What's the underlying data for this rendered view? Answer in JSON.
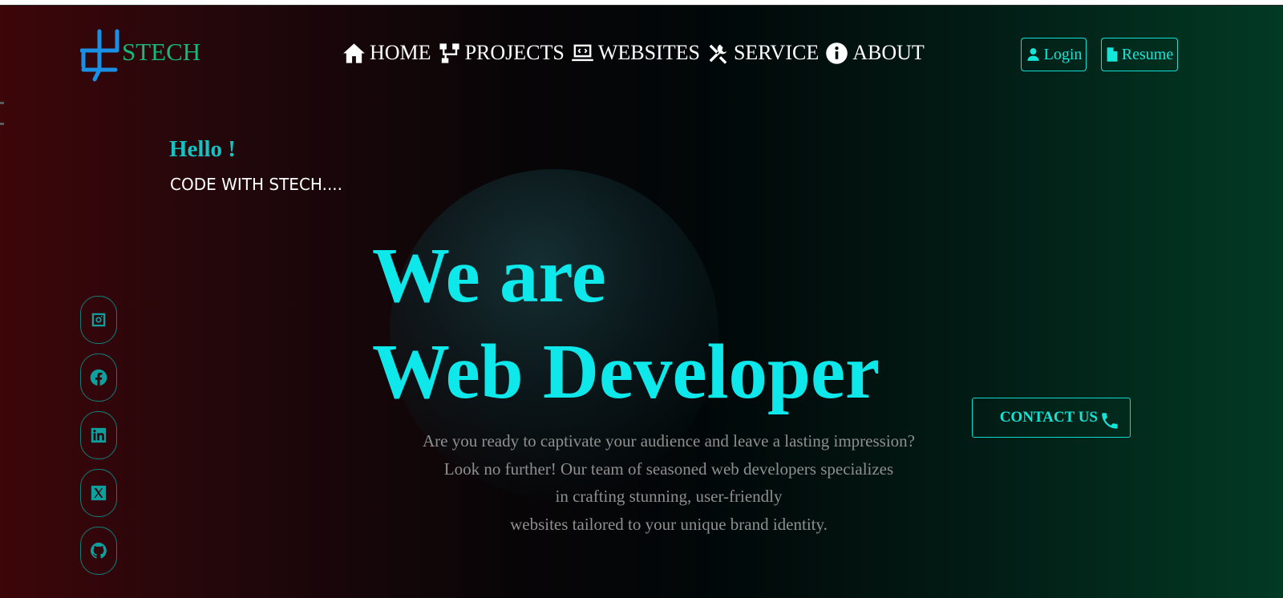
{
  "brand": {
    "name": "STECH"
  },
  "nav": [
    {
      "label": "HOME",
      "icon": "home-icon"
    },
    {
      "label": "PROJECTS",
      "icon": "sitemap-icon"
    },
    {
      "label": "WEBSITES",
      "icon": "laptop-code-icon"
    },
    {
      "label": "SERVICE",
      "icon": "tools-icon"
    },
    {
      "label": "ABOUT",
      "icon": "info-circle-icon"
    }
  ],
  "header": {
    "login_label": "Login",
    "resume_label": "Resume"
  },
  "hero": {
    "greeting": "Hello !",
    "tagline": "CODE WITH STECH....",
    "headline_line1": "We are",
    "headline_line2": "Web Developer",
    "description_lines": [
      "Are you ready to captivate your audience and leave a lasting impression?",
      "Look no further! Our team of seasoned web developers specializes",
      "in crafting stunning, user-friendly",
      "websites tailored to your unique brand identity."
    ],
    "contact_label": "CONTACT US"
  },
  "social": [
    "instagram-icon",
    "facebook-icon",
    "linkedin-icon",
    "x-twitter-icon",
    "github-icon"
  ],
  "colors": {
    "accent": "#0fe8ea",
    "brand": "#17b87b",
    "muted_text": "#8f8f8f"
  }
}
